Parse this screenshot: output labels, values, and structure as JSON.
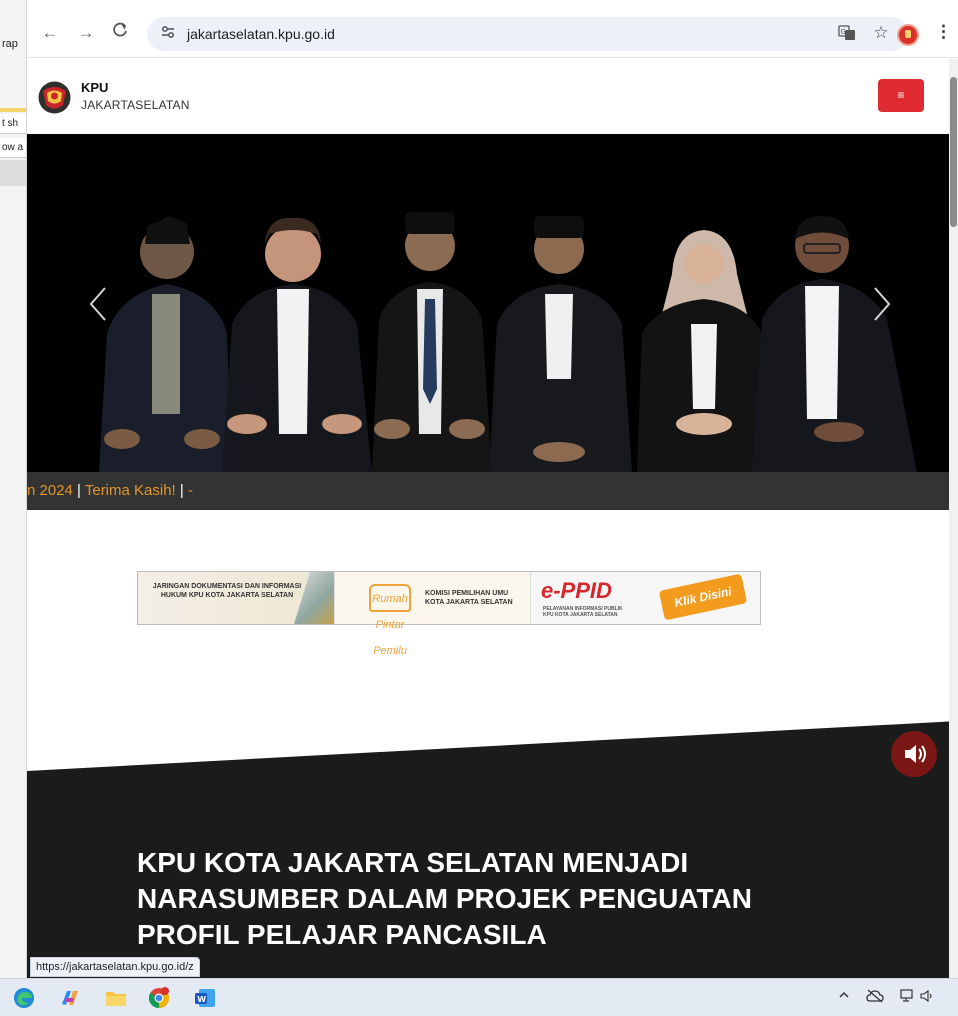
{
  "background_window": {
    "text_1": "rap",
    "text_2": "t sh",
    "text_3": "ow a"
  },
  "browser": {
    "url": "jakartaselatan.kpu.go.id",
    "status_url": "https://jakartaselatan.kpu.go.id/z"
  },
  "site": {
    "brand_top": "KPU",
    "brand_bottom": "JAKARTASELATAN",
    "menu_icon": "≡",
    "colors": {
      "accent_red": "#e02b32",
      "ticker_orange": "#e2952a",
      "dark_section": "#1c1b1b"
    }
  },
  "ticker": {
    "text": "n 2024 | Terima Kasih! | -"
  },
  "banner": {
    "jdih_text": "JARINGAN DOKUMENTASI DAN INFORMASI HUKUM KPU KOTA JAKARTA SELATAN",
    "rumah_pintar_logo": "Rumah Pintar Pemilu",
    "rumah_pintar_text": "KOMISI PEMILIHAN UMU KOTA JAKARTA SELATAN",
    "eppid_title": "e-PPID",
    "eppid_sub": "PELAYANAN INFORMASI PUBLIK KPU KOTA JAKARTA SELATAN",
    "klik_label": "Klik Disini"
  },
  "headline": {
    "text": "KPU KOTA JAKARTA SELATAN MENJADI NARASUMBER DALAM PROJEK PENGUATAN PROFIL PELAJAR PANCASILA"
  },
  "icons": {
    "back": "back-arrow-icon",
    "forward": "forward-arrow-icon",
    "reload": "reload-icon",
    "site_info": "site-info-icon",
    "translate": "translate-icon",
    "bookmark": "star-icon",
    "sound": "speaker-icon"
  }
}
